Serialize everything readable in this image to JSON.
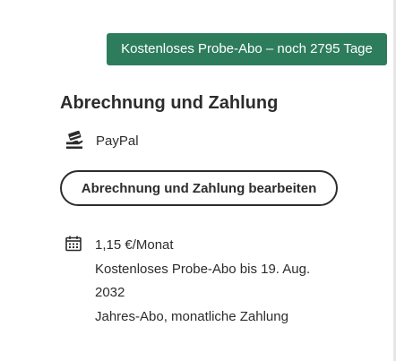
{
  "trial": {
    "badge_text": "Kostenloses Probe-Abo – noch 2795 Tage"
  },
  "billing": {
    "heading": "Abrechnung und Zahlung",
    "payment_method": "PayPal",
    "payment_icon": "credit-card-hand-icon",
    "edit_button_label": "Abrechnung und Zahlung bearbeiten"
  },
  "plan": {
    "icon": "calendar-icon",
    "price": "1,15 €/Monat",
    "trial_end_line_1": "Kostenloses Probe-Abo bis 19. Aug.",
    "trial_end_line_2": "2032",
    "billing_type": "Jahres-Abo, monatliche Zahlung"
  },
  "colors": {
    "badge_background": "#2d7d5d",
    "text": "#2c2c2c",
    "button_border": "#2c2c2c"
  }
}
